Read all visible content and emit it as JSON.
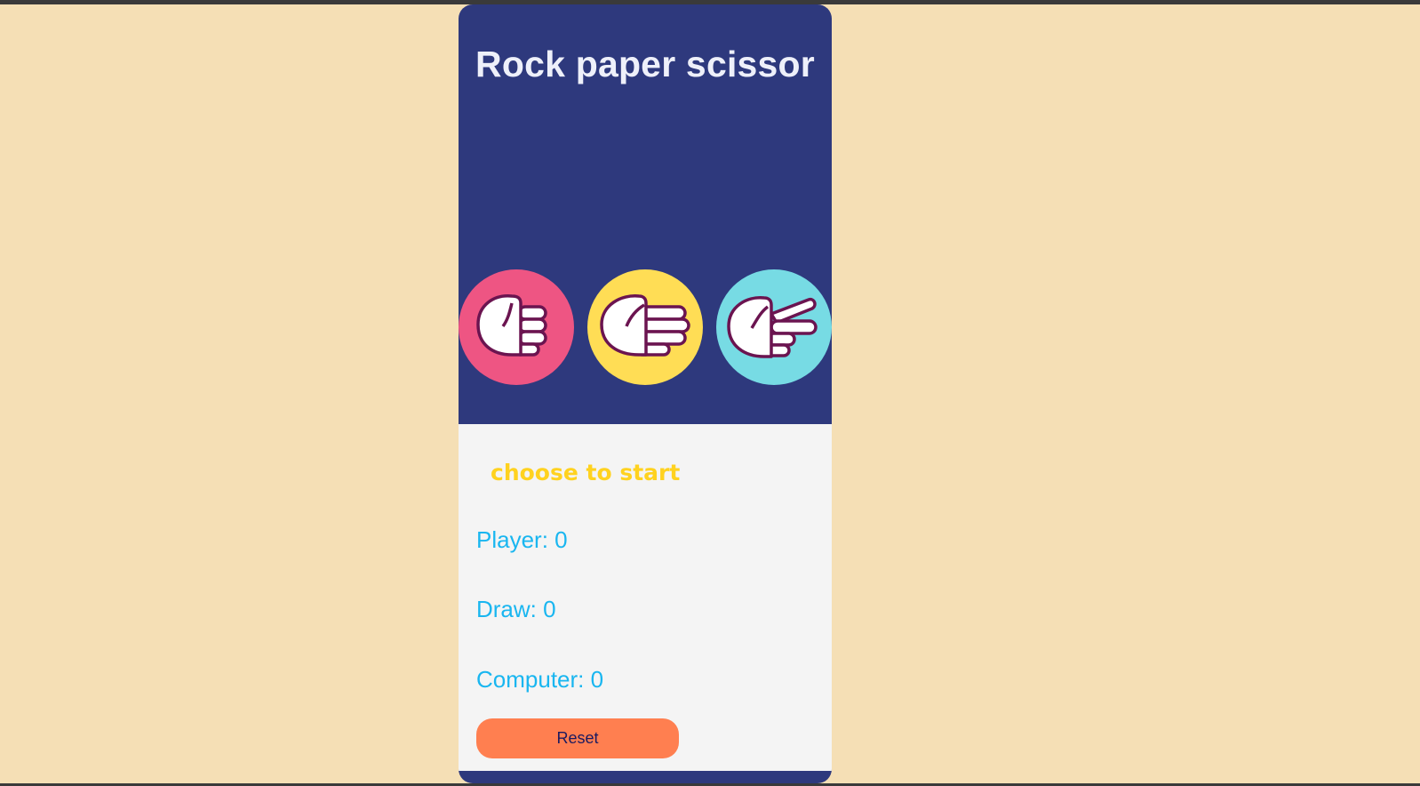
{
  "app": {
    "title": "Rock paper scissor"
  },
  "choices": [
    {
      "id": "rock",
      "icon": "rock-hand-icon",
      "color": "#ee5583"
    },
    {
      "id": "paper",
      "icon": "paper-hand-icon",
      "color": "#ffdd55"
    },
    {
      "id": "scissor",
      "icon": "scissor-hand-icon",
      "color": "#77dbe4"
    }
  ],
  "status": {
    "message": "choose to start"
  },
  "scores": {
    "player_text": "Player: 0",
    "draw_text": "Draw: 0",
    "computer_text": "Computer: 0"
  },
  "controls": {
    "reset_label": "Reset"
  },
  "colors": {
    "page_background": "#f5dfb5",
    "card_background": "#2e397d",
    "panel_background": "#f4f4f4",
    "status_text": "#ffd21f",
    "score_text": "#19b6f0",
    "reset_button": "#ff7f50",
    "hand_outline": "#6b1450"
  }
}
